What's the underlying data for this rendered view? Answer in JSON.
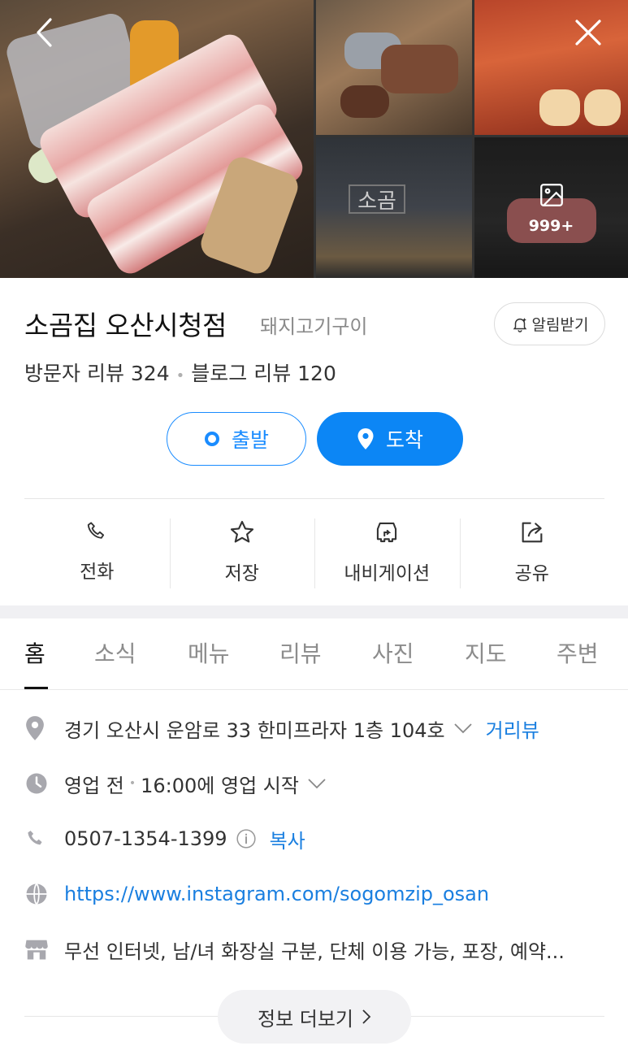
{
  "photos": {
    "more_count": "999+"
  },
  "place": {
    "name": "소곰집 오산시청점",
    "category": "돼지고기구이",
    "alarm_label": "알림받기",
    "visitor_reviews": "방문자 리뷰 324",
    "blog_reviews": "블로그 리뷰 120"
  },
  "route": {
    "start_label": "출발",
    "end_label": "도착"
  },
  "actions": [
    {
      "label": "전화",
      "icon": "phone-icon"
    },
    {
      "label": "저장",
      "icon": "star-icon"
    },
    {
      "label": "내비게이션",
      "icon": "navigation-car-icon"
    },
    {
      "label": "공유",
      "icon": "share-icon"
    }
  ],
  "tabs": [
    "홈",
    "소식",
    "메뉴",
    "리뷰",
    "사진",
    "지도",
    "주변"
  ],
  "details": {
    "address": "경기 오산시 운암로 33 한미프라자 1층 104호",
    "street_view": "거리뷰",
    "hours_status": "영업 전",
    "hours_text": "16:00에 영업 시작",
    "phone": "0507-1354-1399",
    "copy_label": "복사",
    "website": "https://www.instagram.com/sogomzip_osan",
    "amenities": "무선 인터넷, 남/녀 화장실 구분, 단체 이용 가능, 포장, 예약..."
  },
  "more_info_label": "정보 더보기",
  "colors": {
    "accent": "#0c86f5",
    "link": "#1a7fe0"
  }
}
